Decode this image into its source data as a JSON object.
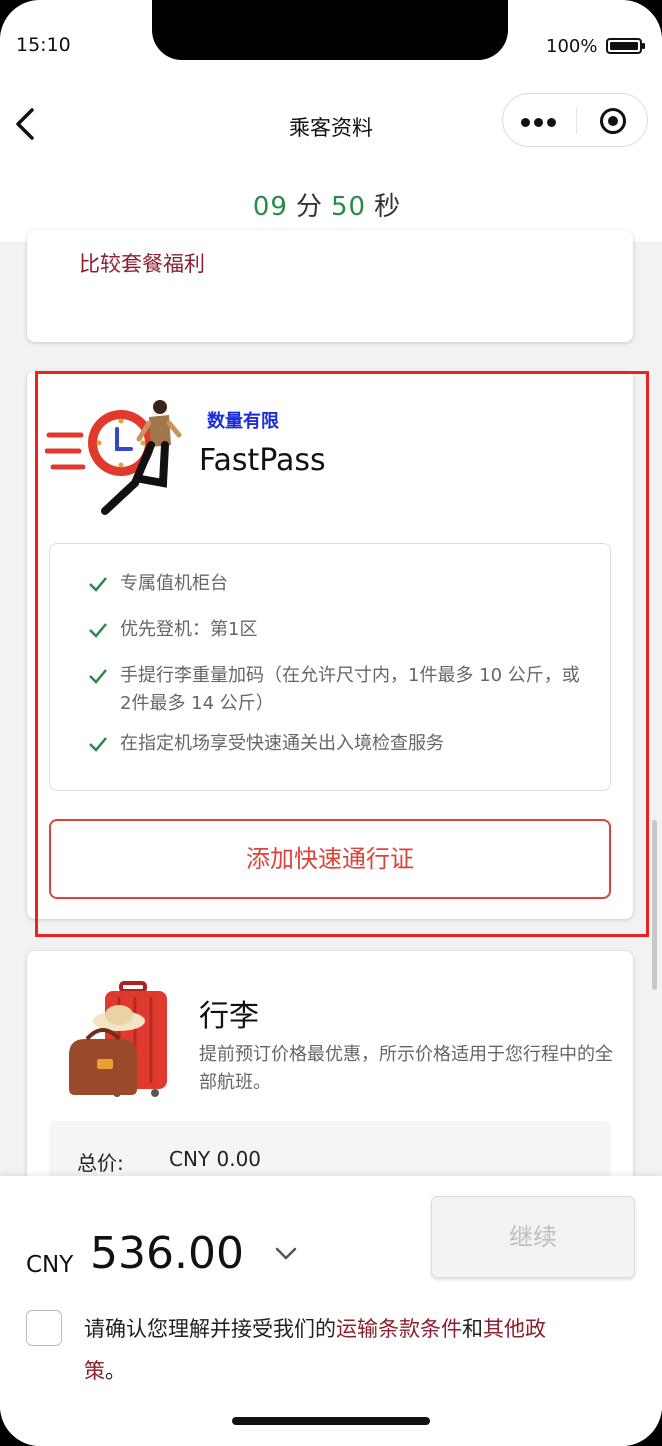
{
  "status": {
    "time": "15:10",
    "battery": "100%"
  },
  "nav": {
    "title": "乘客资料"
  },
  "timer": {
    "minutes": "09",
    "minutes_unit": "分",
    "seconds": "50",
    "seconds_unit": "秒"
  },
  "bundle": {
    "compare_link": "比较套餐福利"
  },
  "fastpass": {
    "badge": "数量有限",
    "title": "FastPass",
    "benefits": [
      "专属值机柜台",
      "优先登机：第1区",
      "手提行李重量加码（在允许尺寸内，1件最多 10 公斤，或2件最多 14 公斤）",
      "在指定机场享受快速通关出入境检查服务"
    ],
    "add_button": "添加快速通行证"
  },
  "luggage": {
    "title": "行李",
    "description": "提前预订价格最优惠，所示价格适用于您行程中的全部航班。",
    "total_label": "总价:",
    "total_value": "CNY 0.00"
  },
  "footer": {
    "currency": "CNY",
    "amount": "536.00",
    "continue_label": "继续",
    "terms_prefix": "请确认您理解并接受我们的",
    "terms_link1": "运输条款条件",
    "terms_and": "和",
    "terms_link2": "其他政策",
    "terms_suffix": "。"
  },
  "colors": {
    "accent_red": "#d9453b",
    "timer_green": "#2a8a4a",
    "link_maroon": "#8b2030",
    "badge_blue": "#1a2dd9",
    "highlight": "#e8241d"
  }
}
